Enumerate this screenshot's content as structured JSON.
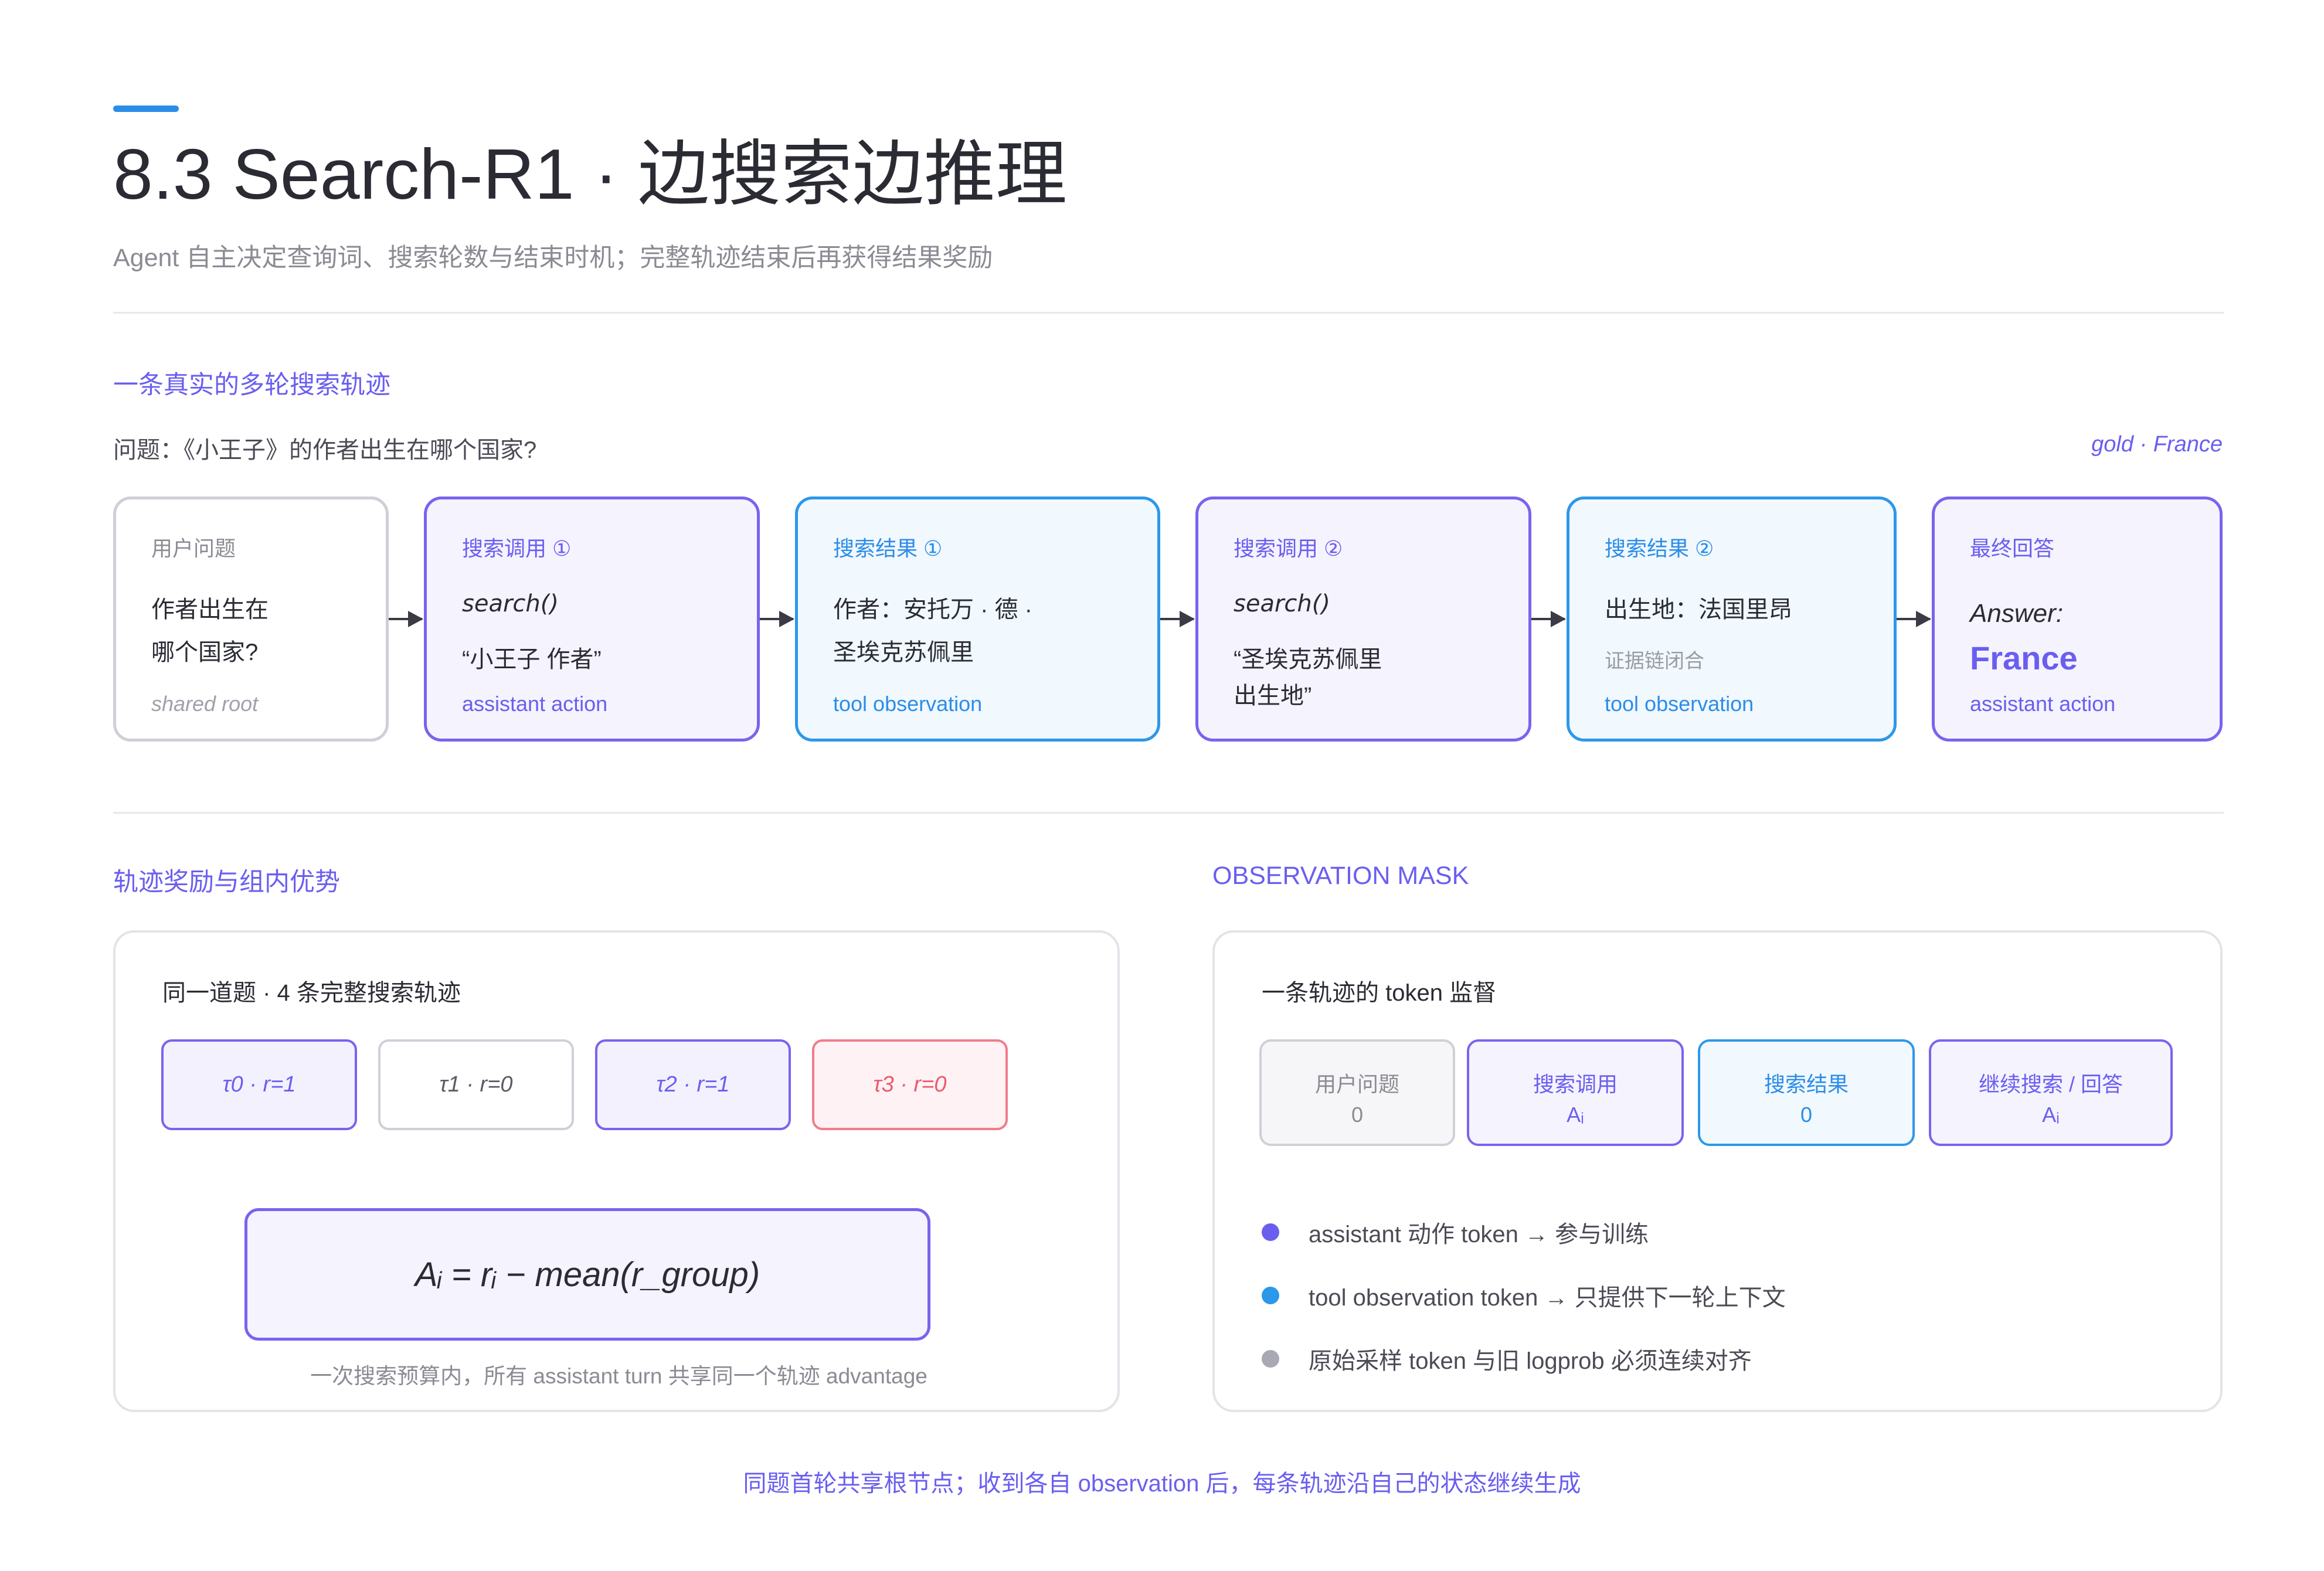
{
  "header": {
    "title": "8.3 Search-R1 · 边搜索边推理",
    "subtitle": "Agent 自主决定查询词、搜索轮数与结束时机；完整轨迹结束后再获得结果奖励"
  },
  "trajectory_section": {
    "title": "一条真实的多轮搜索轨迹",
    "question": "问题：《小王子》的作者出生在哪个国家?",
    "gold": "gold · France",
    "steps": [
      {
        "head": "用户问题",
        "line1": "作者出生在",
        "line2": "哪个国家?",
        "role": "shared root"
      },
      {
        "head": "搜索调用 ①",
        "line1": "search()",
        "line2": "“小王子 作者”",
        "role": "assistant action"
      },
      {
        "head": "搜索结果 ①",
        "line1": "作者：安托万 · 德 ·",
        "line2": "圣埃克苏佩里",
        "role": "tool observation"
      },
      {
        "head": "搜索调用 ②",
        "line1": "search()",
        "line2": "“圣埃克苏佩里",
        "line3": "出生地”"
      },
      {
        "head": "搜索结果 ②",
        "line1": "出生地：法国里昂",
        "note": "证据链闭合",
        "role": "tool observation"
      },
      {
        "head": "最终回答",
        "answer_word": "Answer:",
        "answer_value": "France",
        "role": "assistant action"
      }
    ]
  },
  "reward_section": {
    "title": "轨迹奖励与组内优势",
    "panel_title": "同一道题 · 4 条完整搜索轨迹",
    "trajectories": [
      {
        "label": "τ0 · r=1"
      },
      {
        "label": "τ1 · r=0"
      },
      {
        "label": "τ2 · r=1"
      },
      {
        "label": "τ3 · r=0"
      }
    ],
    "formula": "Aᵢ = rᵢ − mean(r_group)",
    "note": "一次搜索预算内，所有 assistant turn 共享同一个轨迹 advantage"
  },
  "mask_section": {
    "title": "OBSERVATION MASK",
    "panel_title": "一条轨迹的 token 监督",
    "segments": [
      {
        "label": "用户问题",
        "value": "0"
      },
      {
        "label": "搜索调用",
        "value": "Aᵢ"
      },
      {
        "label": "搜索结果",
        "value": "0"
      },
      {
        "label": "继续搜索 / 回答",
        "value": "Aᵢ"
      }
    ],
    "legend": [
      {
        "text": "assistant 动作 token → 参与训练",
        "color": "#6a5ef0"
      },
      {
        "text": "tool observation token → 只提供下一轮上下文",
        "color": "#2c98ea"
      },
      {
        "text": "原始采样 token 与旧 logprob 必须连续对齐",
        "color": "#a8a9b2"
      }
    ]
  },
  "footer": "同题首轮共享根节点；收到各自 observation 后，每条轨迹沿自己的状态继续生成",
  "colors": {
    "purple": "#6a5ef0",
    "blue": "#2c98ea",
    "red": "#ec5a6e",
    "gray": "#cfcfd8"
  }
}
